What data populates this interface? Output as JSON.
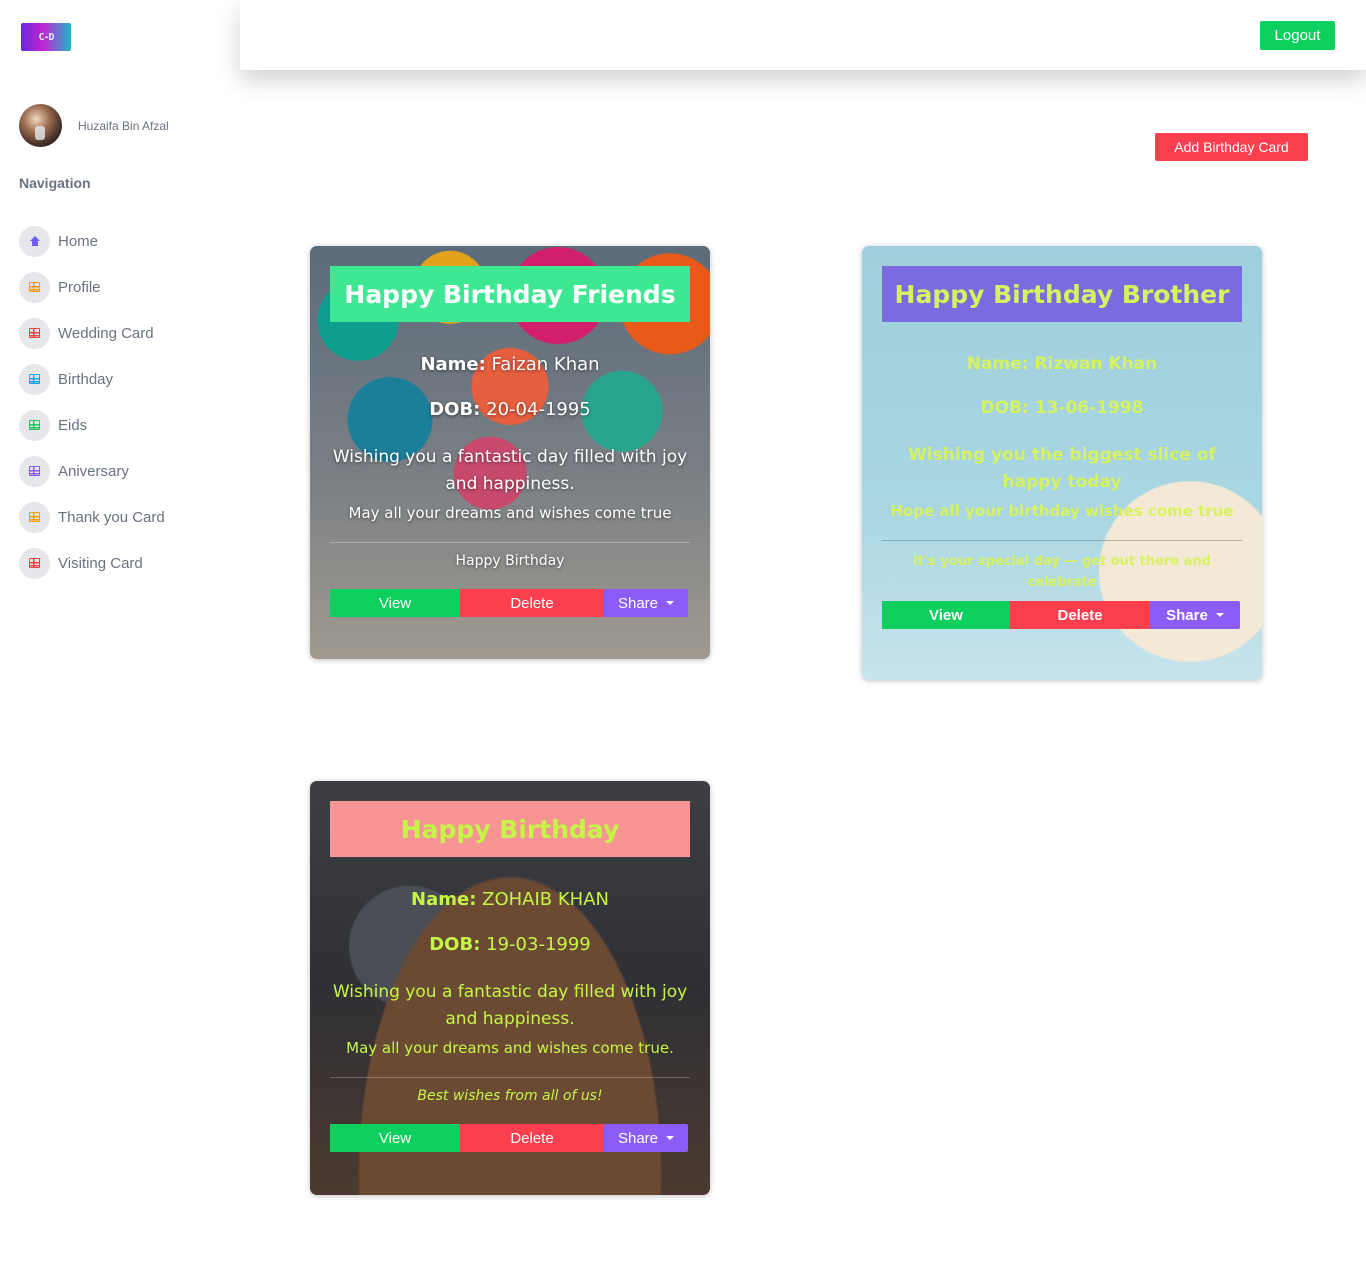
{
  "sidebar": {
    "logo_text": "C-D",
    "user_name": "Huzaifa Bin Afzal",
    "nav_title": "Navigation",
    "items": [
      {
        "label": "Home",
        "icon": "home-icon",
        "color": "#6d5dfc"
      },
      {
        "label": "Profile",
        "icon": "grid-icon",
        "color": "#f59e0b"
      },
      {
        "label": "Wedding Card",
        "icon": "grid-icon",
        "color": "#ef4444"
      },
      {
        "label": "Birthday",
        "icon": "grid-icon",
        "color": "#0ea5e9"
      },
      {
        "label": "Eids",
        "icon": "grid-icon",
        "color": "#22c55e"
      },
      {
        "label": "Aniversary",
        "icon": "grid-icon",
        "color": "#8b5cf6"
      },
      {
        "label": "Thank you Card",
        "icon": "grid-icon",
        "color": "#f59e0b"
      },
      {
        "label": "Visiting Card",
        "icon": "grid-icon",
        "color": "#ef4444"
      }
    ]
  },
  "header": {
    "logout_label": "Logout"
  },
  "main": {
    "add_card_label": "Add Birthday Card"
  },
  "cards": [
    {
      "title": "Happy Birthday Friends",
      "name_label": "Name:",
      "name": "Faizan Khan",
      "dob_label": "DOB:",
      "dob": "20-04-1995",
      "wish": "Wishing you a fantastic day filled with joy and happiness.",
      "wish2": "May all your dreams and wishes come true",
      "footer": "Happy Birthday",
      "view_label": "View",
      "delete_label": "Delete",
      "share_label": "Share"
    },
    {
      "title": "Happy Birthday Brother",
      "name_label": "Name:",
      "name": "Rizwan Khan",
      "dob_label": "DOB:",
      "dob": "13-06-1998",
      "wish": "Wishing you the biggest slice of happy today",
      "wish2": "Hope all your birthday wishes come true",
      "footer": "It's your special day — get out there and celebrate",
      "view_label": "View",
      "delete_label": "Delete",
      "share_label": "Share"
    },
    {
      "title": "Happy Birthday",
      "name_label": "Name:",
      "name": "ZOHAIB KHAN",
      "dob_label": "DOB:",
      "dob": "19-03-1999",
      "wish": "Wishing you a fantastic day filled with joy and happiness.",
      "wish2": "May all your dreams and wishes come true.",
      "footer": "Best wishes from all of us!",
      "view_label": "View",
      "delete_label": "Delete",
      "share_label": "Share"
    }
  ],
  "colors": {
    "success": "#0ccf5e",
    "danger": "#fb3f4f",
    "purple": "#8b5cf6"
  }
}
